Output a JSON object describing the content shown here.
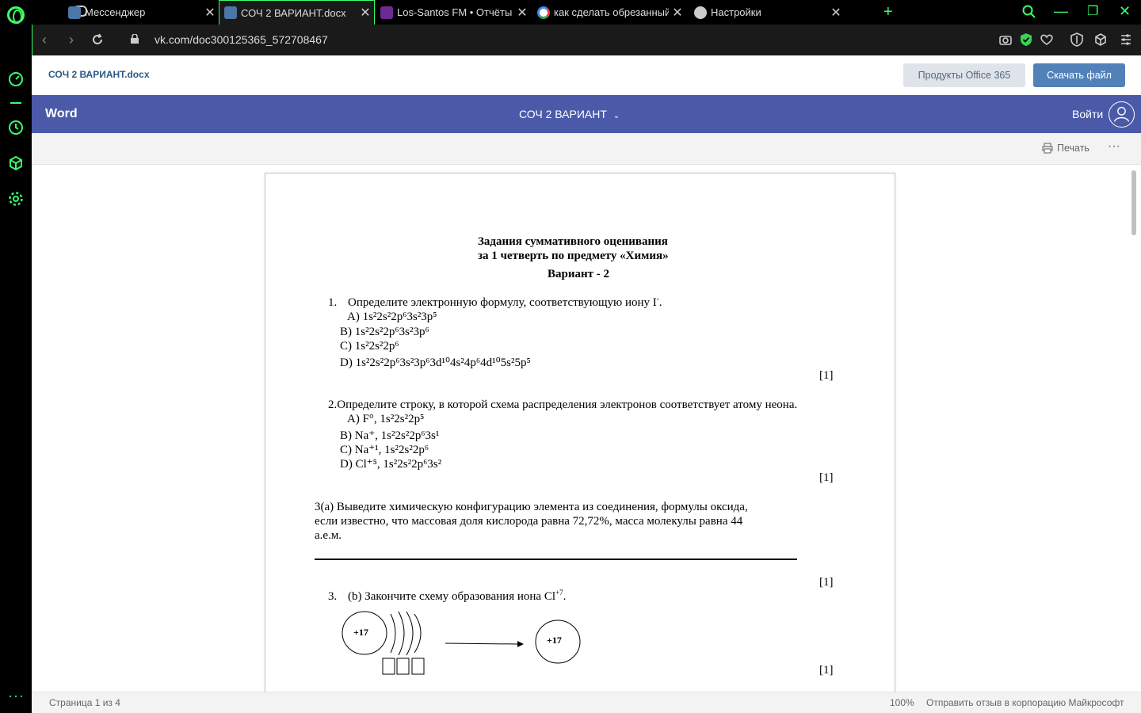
{
  "browser": {
    "tabs": [
      {
        "title": "Мессенджер",
        "favicon_color": "#4a76a8"
      },
      {
        "title": "СОЧ 2 ВАРИАНТ.docx",
        "favicon_color": "#4a76a8"
      },
      {
        "title": "Los-Santos FM • Отчёты со",
        "favicon_color": "#6a2c91"
      },
      {
        "title": "как сделать обрезанный с",
        "favicon_color": "#ffffff"
      },
      {
        "title": "Настройки",
        "favicon_color": "#cccccc"
      }
    ],
    "url": "vk.com/doc300125365_572708467",
    "accent_color": "#39ff6a"
  },
  "vk_header": {
    "doc_title": "СОЧ 2 ВАРИАНТ.docx",
    "office_button": "Продукты Office 365",
    "download_button": "Скачать файл"
  },
  "word_bar": {
    "brand": "Word",
    "doc_name": "СОЧ 2 ВАРИАНТ",
    "sign_in": "Войти",
    "color": "#4b5aa8"
  },
  "command_bar": {
    "print_label": "Печать",
    "more_label": "···"
  },
  "document": {
    "title_line1": "Задания суммативного оценивания",
    "title_line2": "за 1 четверть по предмету «Химия»",
    "variant": "Вариант - 2",
    "q1": {
      "number": "1.",
      "text": "Определите электронную формулу, соответствующую иону I",
      "charge": "-",
      "end": ".",
      "opt_a": "A) 1s²2s²2p⁶3s²3p⁵",
      "opt_b": "B) 1s²2s²2p⁶3s²3p⁶",
      "opt_c": "C) 1s²2s²2p⁶",
      "opt_d": "D) 1s²2s²2p⁶3s²3p⁶3d¹⁰4s²4p⁶4d¹⁰5s²5p⁵",
      "score": "[1]"
    },
    "q2": {
      "text": "2.Определите строку, в которой схема распределения электронов соответствует атому неона.",
      "opt_a": "A) F°,  1s²2s²2p⁵",
      "opt_b": "B) Na⁺, 1s²2s²2p⁶3s¹",
      "opt_c": "C) Na⁺¹, 1s²2s²2p⁶",
      "opt_d": "D) Cl⁺⁵, 1s²2s²2p⁶3s²",
      "score": "[1]"
    },
    "q3a": {
      "line1": "3(a) Выведите химическую конфигурацию элемента из соединения, формулы оксида,",
      "line2": "если известно, что массовая доля кислорода равна 72,72%, масса молекулы равна 44",
      "line3": "а.е.м.",
      "score": "[1]"
    },
    "q3b": {
      "number": "3.",
      "text": "(b) Закончите схему образования иона Cl",
      "charge": "+7",
      "end": ".",
      "nucleus_left": "+17",
      "nucleus_right": "+17",
      "score": "[1]"
    }
  },
  "status_bar": {
    "page": "Страница 1 из 4",
    "zoom": "100%",
    "feedback": "Отправить отзыв в корпорацию Майкрософт"
  }
}
